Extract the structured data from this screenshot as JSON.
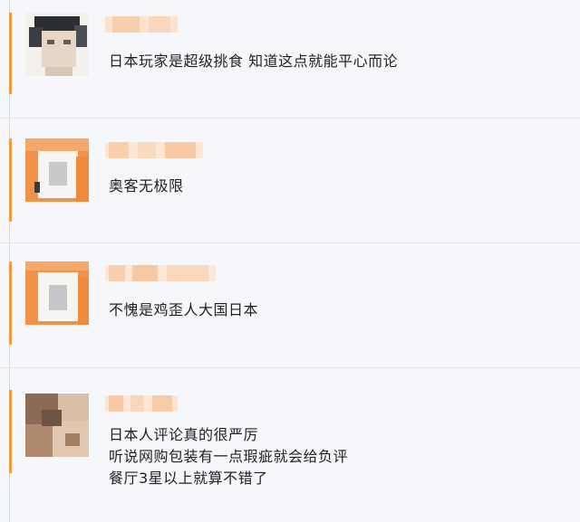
{
  "comments": [
    {
      "avatar": "blurred-person-avatar",
      "username": "",
      "lines": [
        "日本玩家是超级挑食 知道这点就能平心而论"
      ]
    },
    {
      "avatar": "blurred-orange-avatar",
      "username": "",
      "lines": [
        "奥客无极限"
      ]
    },
    {
      "avatar": "blurred-orange-avatar",
      "username": "",
      "lines": [
        "不愧是鸡歪人大国日本"
      ]
    },
    {
      "avatar": "blurred-photo-avatar",
      "username": "",
      "lines": [
        "日本人评论真的很严厉",
        "听说网购包装有一点瑕疵就会给负评",
        "餐厅3星以上就算不错了"
      ]
    }
  ],
  "colors": {
    "accent": "#f39a3d",
    "background": "#f6f7fb",
    "text": "#222222",
    "divider": "#e3e5ea"
  }
}
